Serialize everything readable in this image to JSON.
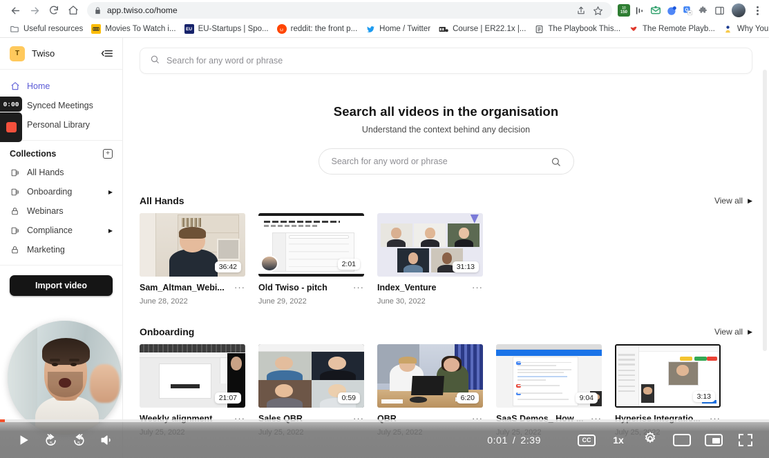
{
  "browser": {
    "url": "app.twiso.co/home",
    "nav": {
      "back": "back-arrow",
      "forward": "forward-arrow",
      "reload": "reload",
      "home": "home"
    },
    "omnibox_actions": [
      "share-icon",
      "bookmark-star-icon"
    ],
    "extensions": [
      "cash-150-icon",
      "analytics-icon",
      "mail-icon",
      "blue-circle-icon",
      "translate-icon",
      "puzzle-icon",
      "sidepanel-icon"
    ],
    "profile": "user-avatar",
    "menu": "three-dot-menu",
    "bookmarks": [
      {
        "label": "Useful resources",
        "icon": "folder-icon"
      },
      {
        "label": "Movies To Watch i...",
        "icon": "film-icon"
      },
      {
        "label": "EU-Startups | Spo...",
        "icon": "eu-icon"
      },
      {
        "label": "reddit: the front p...",
        "icon": "reddit-icon"
      },
      {
        "label": "Home / Twitter",
        "icon": "twitter-icon"
      },
      {
        "label": "Course | ER22.1x |...",
        "icon": "course-icon"
      },
      {
        "label": "The Playbook This...",
        "icon": "playbook-icon"
      },
      {
        "label": "The Remote Playb...",
        "icon": "remote-icon"
      },
      {
        "label": "Why You Should B...",
        "icon": "notion-icon"
      }
    ],
    "bookmarks_overflow": "»"
  },
  "sidebar": {
    "workspace": {
      "initial": "T",
      "name": "Twiso"
    },
    "collapse_icon": "collapse-sidebar-icon",
    "nav": [
      {
        "label": "Home",
        "icon": "home-icon",
        "active": true
      },
      {
        "label": "Synced Meetings",
        "icon": "sync-icon",
        "active": false
      },
      {
        "label": "Personal Library",
        "icon": "library-icon",
        "active": false
      }
    ],
    "collections": {
      "title": "Collections",
      "add_icon": "plus-icon",
      "items": [
        {
          "label": "All Hands",
          "icon": "collection-icon",
          "expandable": false
        },
        {
          "label": "Onboarding",
          "icon": "collection-icon",
          "expandable": true
        },
        {
          "label": "Webinars",
          "icon": "lock-icon",
          "expandable": false
        },
        {
          "label": "Compliance",
          "icon": "collection-icon",
          "expandable": true
        },
        {
          "label": "Marketing",
          "icon": "lock-icon",
          "expandable": false
        }
      ]
    },
    "import_label": "Import video"
  },
  "recorder": {
    "timer": "0:00",
    "stop_icon": "stop-square-icon",
    "webcam": "webcam-bubble"
  },
  "main": {
    "top_search_placeholder": "Search for any word or phrase",
    "search_icon": "search-icon",
    "hero": {
      "title": "Search all videos in the organisation",
      "subtitle": "Understand the context behind any decision",
      "placeholder": "Search for any word or phrase",
      "search_icon": "search-icon"
    },
    "sections": [
      {
        "title": "All Hands",
        "view_all": "View all",
        "view_all_caret": "▶",
        "cards": [
          {
            "title": "Sam_Altman_Webi...",
            "date": "June 28, 2022",
            "duration": "36:42",
            "art": "t-sam",
            "menu": "···"
          },
          {
            "title": "Old Twiso - pitch",
            "date": "June 29, 2022",
            "duration": "2:01",
            "art": "t-ui",
            "menu": "···"
          },
          {
            "title": "Index_Venture",
            "date": "June 30, 2022",
            "duration": "31:13",
            "art": "t-grid",
            "menu": "···"
          }
        ]
      },
      {
        "title": "Onboarding",
        "view_all": "View all",
        "view_all_caret": "▶",
        "cards": [
          {
            "title": "Weekly alignment",
            "date": "July 25, 2022",
            "duration": "21:07",
            "art": "t-browser",
            "menu": "···"
          },
          {
            "title": "Sales QBR",
            "date": "July 25, 2022",
            "duration": "0:59",
            "art": "t-4up",
            "menu": "···"
          },
          {
            "title": "QBR",
            "date": "July 25, 2022",
            "duration": "6:20",
            "art": "t-room",
            "menu": "···"
          },
          {
            "title": "SaaS Demos_ How ...",
            "date": "July 25, 2022",
            "duration": "9:04",
            "art": "t-doc",
            "menu": "···"
          },
          {
            "title": "Hyperise Integratio...",
            "date": "July 25, 2022",
            "duration": "3:13",
            "art": "t-crm",
            "menu": "···"
          }
        ]
      }
    ]
  },
  "player": {
    "play_icon": "play-icon",
    "rewind_label": "5",
    "forward_label": "5",
    "volume_icon": "volume-icon",
    "current_time": "0:01",
    "separator": "/",
    "total_time": "2:39",
    "cc_label": "CC",
    "speed": "1x",
    "settings_icon": "gear-icon",
    "theater_icon": "theater-mode-icon",
    "pip_icon": "picture-in-picture-icon",
    "fullscreen_icon": "fullscreen-icon",
    "progress_color": "#f4512c"
  },
  "colors": {
    "accent": "#5b5bd6",
    "brand_badge": "#ffc95c",
    "record_red": "#f4503c",
    "dark_button": "#151515"
  }
}
